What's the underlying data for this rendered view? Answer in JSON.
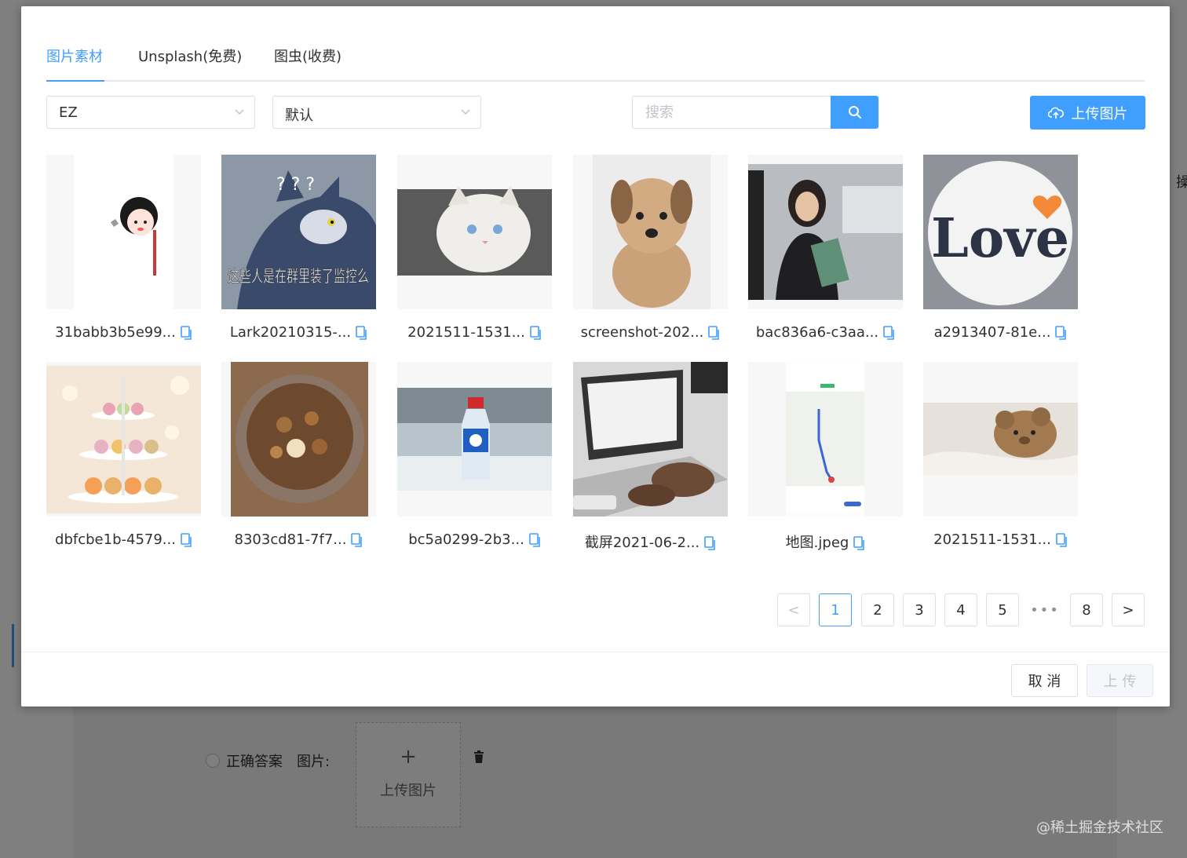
{
  "tabs": [
    "图片素材",
    "Unsplash(免费)",
    "图虫(收费)"
  ],
  "filters": {
    "group": "EZ",
    "sort": "默认"
  },
  "search": {
    "placeholder": "搜索"
  },
  "toolbar": {
    "upload_label": "上传图片"
  },
  "images": [
    {
      "name": "31babb3b5e99...",
      "icon": "cartoon-girl-thumbnail"
    },
    {
      "name": "Lark20210315-...",
      "icon": "cartoon-cat-meme-thumbnail",
      "meme_text": "这些人是在群里装了监控么",
      "meme_marks": "? ? ?"
    },
    {
      "name": "2021511-1531...",
      "icon": "white-cat-thumbnail"
    },
    {
      "name": "screenshot-202...",
      "icon": "puppy-thumbnail"
    },
    {
      "name": "bac836a6-c3aa...",
      "icon": "business-woman-thumbnail"
    },
    {
      "name": "a2913407-81e...",
      "icon": "love-plate-thumbnail",
      "art_text": "Love"
    },
    {
      "name": "dbfcbe1b-4579...",
      "icon": "macaron-stand-thumbnail"
    },
    {
      "name": "8303cd81-7f7...",
      "icon": "beef-bowl-thumbnail"
    },
    {
      "name": "bc5a0299-2b3...",
      "icon": "water-bottle-thumbnail"
    },
    {
      "name": "截屏2021-06-2...",
      "icon": "laptop-typing-thumbnail"
    },
    {
      "name": "地图.jpeg",
      "icon": "map-screenshot-thumbnail"
    },
    {
      "name": "2021511-1531...",
      "icon": "teddy-bear-thumbnail"
    }
  ],
  "pagination": {
    "prev": "<",
    "next": ">",
    "pages": [
      "1",
      "2",
      "3",
      "4",
      "5"
    ],
    "ellipsis": "•••",
    "last": "8",
    "current": "1"
  },
  "footer": {
    "cancel": "取 消",
    "confirm": "上 传"
  },
  "background_form": {
    "radio_label": "正确答案",
    "image_label": "图片:",
    "upload_plus": "+",
    "upload_text": "上传图片",
    "side_char": "操"
  },
  "watermark": "@稀土掘金技术社区",
  "colors": {
    "primary": "#409eff",
    "border": "#dcdfe6",
    "text": "#303133",
    "placeholder": "#c0c4cc"
  }
}
